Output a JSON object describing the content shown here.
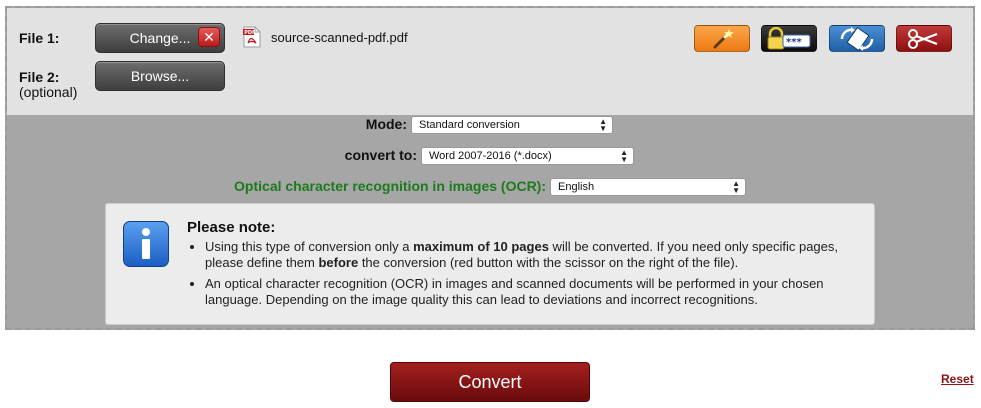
{
  "file1": {
    "label": "File 1:",
    "change_button": "Change...",
    "remove_icon": "x-icon",
    "file_icon": "pdf-icon",
    "file_name": "source-scanned-pdf.pdf"
  },
  "file2": {
    "label": "File 2:",
    "sublabel": "(optional)",
    "browse_button": "Browse..."
  },
  "tools": [
    {
      "name": "magic-wand-icon",
      "color": "#f08a22"
    },
    {
      "name": "lock-password-icon",
      "color": "#111111"
    },
    {
      "name": "rotate-page-icon",
      "color": "#2b6cb5"
    },
    {
      "name": "scissors-icon",
      "color": "#a51f1f"
    }
  ],
  "mode": {
    "label": "Mode:",
    "selected": "Standard conversion"
  },
  "convert_to": {
    "label": "convert to:",
    "selected": "Word 2007-2016 (*.docx)"
  },
  "ocr": {
    "label": "Optical character recognition in images (OCR):",
    "selected": "English",
    "label_color": "#1e7a1e"
  },
  "note": {
    "title": "Please note:",
    "item1_prefix": "Using this type of conversion only a ",
    "item1_bold1": "maximum of 10 pages",
    "item1_mid": " will be converted. If you need only specific pages, please define them ",
    "item1_bold2": "before",
    "item1_suffix": " the conversion (red button with the scissor on the right of the file).",
    "item2": "An optical character recognition (OCR) in images and scanned documents will be performed in your chosen language. Depending on the image quality this can lead to deviations and incorrect recognitions."
  },
  "convert_button": "Convert",
  "reset_link": "Reset"
}
